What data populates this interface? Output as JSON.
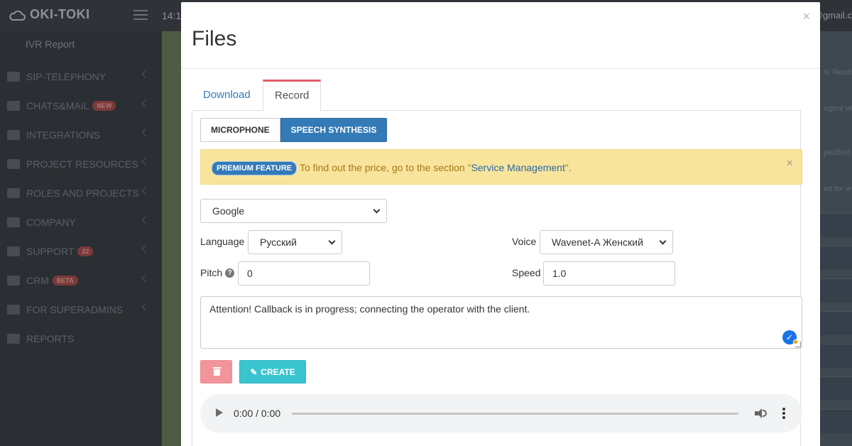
{
  "app": {
    "logo_text": "OKI-TOKI",
    "time": "14:1",
    "user_email": "@gmail.c"
  },
  "sidebar": {
    "sub_item": "IVR Report",
    "items": [
      {
        "label": "SIP-TELEPHONY",
        "icon": "phone-icon",
        "badge": ""
      },
      {
        "label": "CHATS&MAIL",
        "icon": "chat-icon",
        "badge": "NEW"
      },
      {
        "label": "INTEGRATIONS",
        "icon": "gears-icon",
        "badge": ""
      },
      {
        "label": "PROJECT RESOURCES",
        "icon": "grid-icon",
        "badge": ""
      },
      {
        "label": "ROLES AND PROJECTS",
        "icon": "toggle-icon",
        "badge": ""
      },
      {
        "label": "COMPANY",
        "icon": "bar-chart-icon",
        "badge": ""
      },
      {
        "label": "SUPPORT",
        "icon": "wrench-icon",
        "badge": "22"
      },
      {
        "label": "CRM",
        "icon": "table-icon",
        "badge": "BETA"
      },
      {
        "label": "FOR SUPERADMINS",
        "icon": "exclamation-icon",
        "badge": ""
      },
      {
        "label": "REPORTS",
        "icon": "line-chart-icon",
        "badge": ""
      }
    ]
  },
  "background_right_text": [
    "is 'Read",
    "agent wh",
    "pecified",
    "ed for w"
  ],
  "modal": {
    "title": "Files",
    "close_symbol": "×",
    "tabs": {
      "download": "Download",
      "record": "Record",
      "active": "record"
    },
    "mode_buttons": {
      "microphone": "MICROPHONE",
      "speech_synthesis": "SPEECH SYNTHESIS",
      "active": "speech_synthesis"
    },
    "alert": {
      "badge": "PREMIUM FEATURE",
      "text_before": "To find out the price, go to the section \"",
      "link": "Service Management",
      "text_after": "\".",
      "close_symbol": "×"
    },
    "form": {
      "provider": "Google",
      "language_label": "Language",
      "language_value": "Русский",
      "voice_label": "Voice",
      "voice_value": "Wavenet-A Женский",
      "pitch_label": "Pitch",
      "pitch_value": "0",
      "speed_label": "Speed",
      "speed_value": "1.0",
      "text": "Attention! Callback is in progress; connecting the operator with the client."
    },
    "buttons": {
      "create": "CREATE"
    },
    "audio": {
      "time": "0:00 / 0:00"
    }
  }
}
